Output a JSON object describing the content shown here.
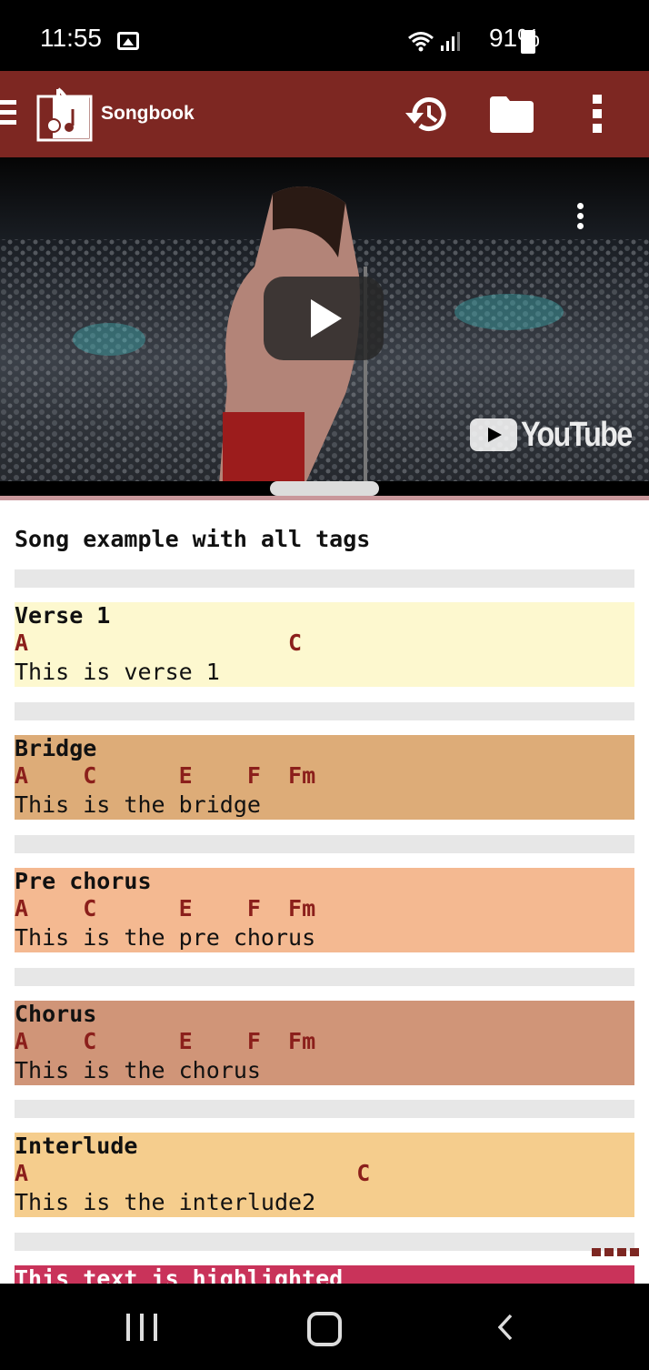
{
  "status_bar": {
    "time": "11:55",
    "battery": "91%"
  },
  "app_bar": {
    "title": "Songbook"
  },
  "video": {
    "logo_text": "YouTube"
  },
  "song": {
    "title": "Song example with all tags",
    "sections": [
      {
        "name": "Verse 1",
        "chords": "A                   C",
        "lyrics": "This is verse 1",
        "color": "#fdf8cf"
      },
      {
        "name": "Bridge",
        "chords": "A    C      E    F  Fm",
        "lyrics": "This is the bridge",
        "color": "#ddac78"
      },
      {
        "name": "Pre chorus",
        "chords": "A    C      E    F  Fm",
        "lyrics": "This is the pre chorus",
        "color": "#f4b991"
      },
      {
        "name": "Chorus",
        "chords": "A    C      E    F  Fm",
        "lyrics": "This is the chorus",
        "color": "#d09578"
      },
      {
        "name": "Interlude",
        "chords": "A                        C",
        "lyrics": "This is the interlude2",
        "color": "#f5cd8d"
      }
    ],
    "highlight": {
      "text": "This text is highlighted",
      "color": "#c9335a"
    }
  },
  "colors": {
    "app_bar": "#7d2722",
    "chord": "#8b1f1b",
    "gap": "#e7e7e7"
  }
}
